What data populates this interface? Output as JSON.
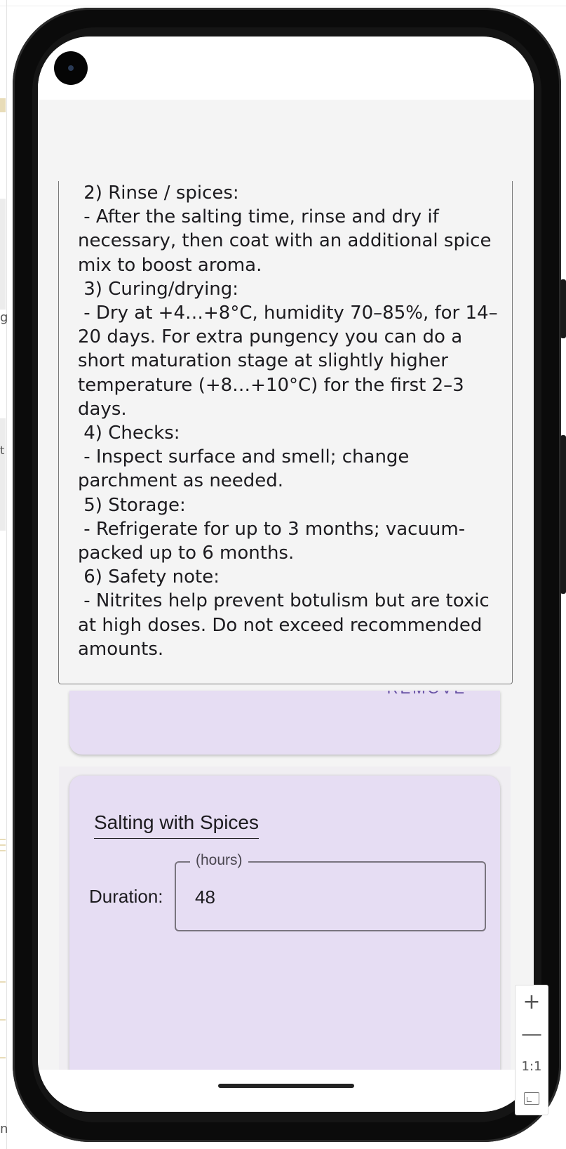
{
  "background": {
    "edge_chars": [
      "g",
      "t",
      "n"
    ]
  },
  "notes": {
    "text": " 2) Rinse / spices:\n - After the salting time, rinse and dry if necessary, then coat with an additional spice mix to boost aroma.\n 3) Curing/drying:\n - Dry at +4…+8°C, humidity 70–85%, for 14–20 days. For extra pungency you can do a short maturation stage at slightly higher temperature (+8…+10°C) for the first 2–3 days.\n 4) Checks:\n - Inspect surface and smell; change parchment as needed.\n 5) Storage:\n - Refrigerate for up to 3 months; vacuum-packed up to 6 months.\n 6) Safety note:\n - Nitrites help prevent botulism but are toxic at high doses. Do not exceed recommended amounts."
  },
  "previous_card": {
    "action_label": "REMOVE"
  },
  "step_card": {
    "title": "Salting with Spices",
    "duration_label": "Duration:",
    "duration_unit_legend": "(hours)",
    "duration_value": "48"
  },
  "zoom_controls": {
    "zoom_in": "+",
    "zoom_out": "—",
    "reset": "1:1"
  },
  "colors": {
    "card_background": "#e6ddf3",
    "app_background": "#f4f4f4",
    "text": "#1c1b1f"
  }
}
